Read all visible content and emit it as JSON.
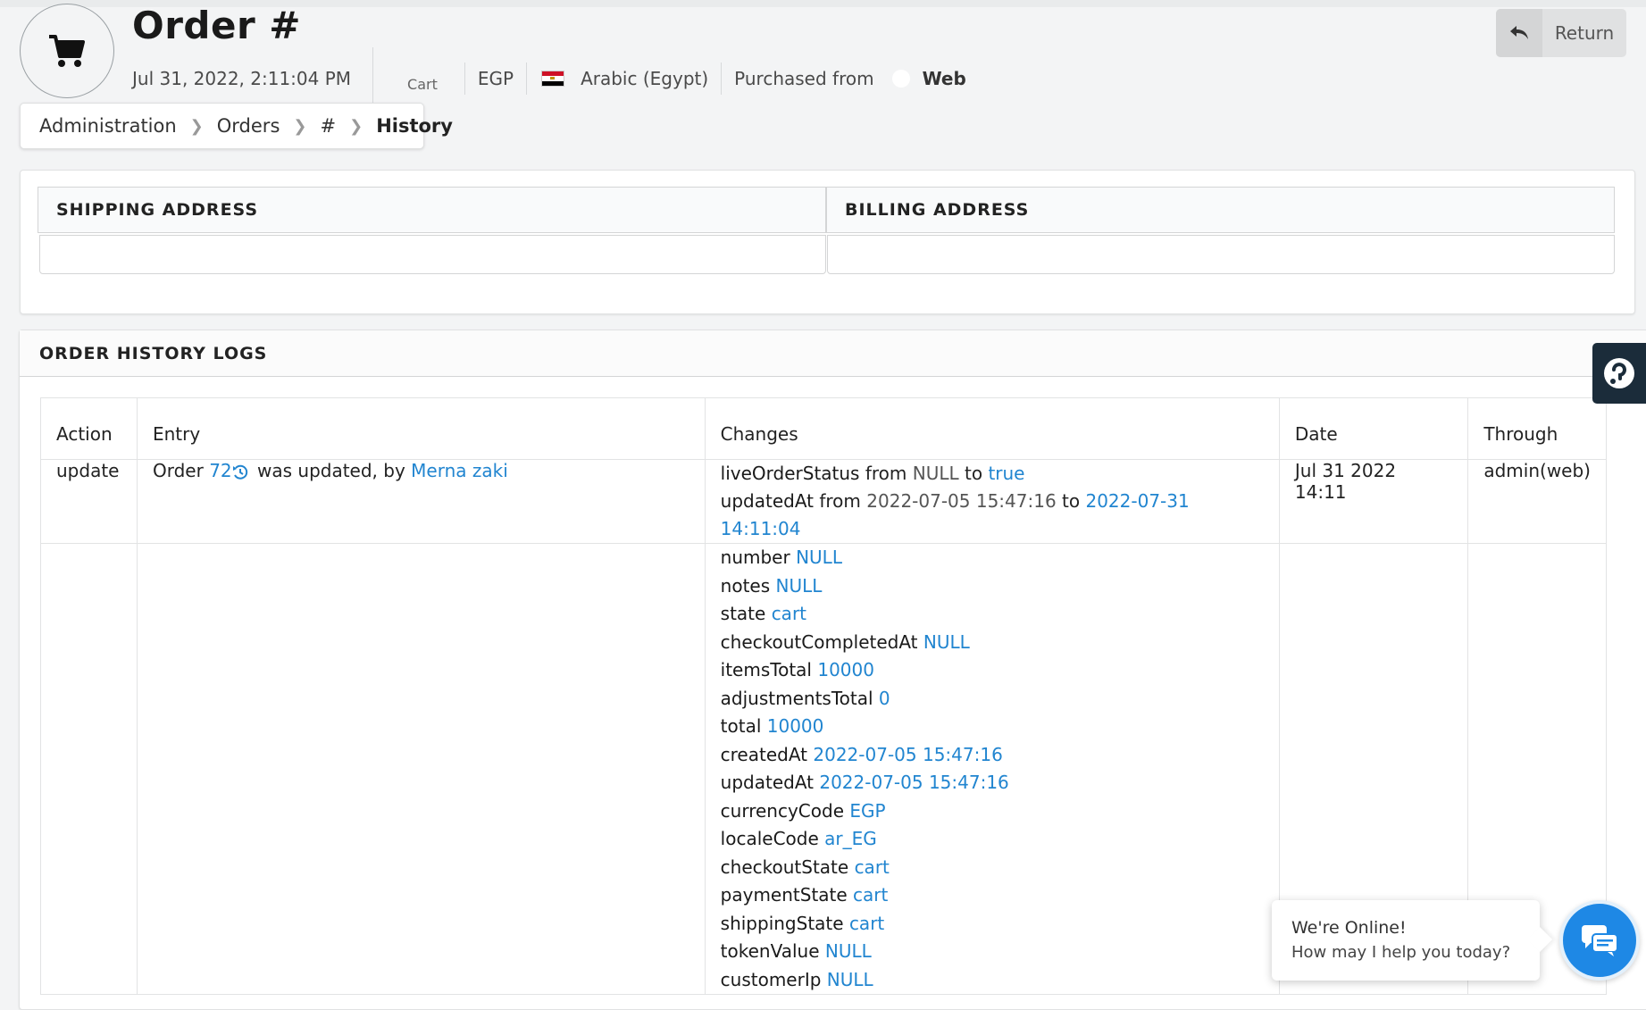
{
  "header": {
    "title": "Order #",
    "date": "Jul 31, 2022, 2:11:04 PM",
    "cart_label": "Cart",
    "currency": "EGP",
    "locale": "Arabic (Egypt)",
    "purchased_from": "Purchased from",
    "channel": "Web"
  },
  "return_button": {
    "label": "Return"
  },
  "breadcrumb": {
    "items": [
      "Administration",
      "Orders",
      "#"
    ],
    "active": "History"
  },
  "addresses": {
    "shipping_title": "SHIPPING ADDRESS",
    "billing_title": "BILLING ADDRESS"
  },
  "history": {
    "title": "ORDER HISTORY LOGS",
    "columns": [
      "Action",
      "Entry",
      "Changes",
      "Date",
      "Through"
    ],
    "row1": {
      "action": "update",
      "entry_prefix": "Order",
      "entry_id": "72",
      "entry_middle": "was updated, by",
      "entry_user": "Merna zaki",
      "changes": [
        {
          "key": "liveOrderStatus",
          "from_label": "from",
          "from": "NULL",
          "to_label": "to",
          "to": "true"
        },
        {
          "key": "updatedAt",
          "from_label": "from",
          "from": "2022-07-05 15:47:16",
          "to_label": "to",
          "to": "2022-07-31 14:11:04"
        }
      ],
      "date": "Jul 31 2022 14:11",
      "through": "admin(web)"
    },
    "row2": {
      "changes": [
        {
          "key": "number",
          "value": "NULL"
        },
        {
          "key": "notes",
          "value": "NULL"
        },
        {
          "key": "state",
          "value": "cart"
        },
        {
          "key": "checkoutCompletedAt",
          "value": "NULL"
        },
        {
          "key": "itemsTotal",
          "value": "10000"
        },
        {
          "key": "adjustmentsTotal",
          "value": "0"
        },
        {
          "key": "total",
          "value": "10000"
        },
        {
          "key": "createdAt",
          "value": "2022-07-05 15:47:16"
        },
        {
          "key": "updatedAt",
          "value": "2022-07-05 15:47:16"
        },
        {
          "key": "currencyCode",
          "value": "EGP"
        },
        {
          "key": "localeCode",
          "value": "ar_EG"
        },
        {
          "key": "checkoutState",
          "value": "cart"
        },
        {
          "key": "paymentState",
          "value": "cart"
        },
        {
          "key": "shippingState",
          "value": "cart"
        },
        {
          "key": "tokenValue",
          "value": "NULL"
        },
        {
          "key": "customerIp",
          "value": "NULL"
        }
      ]
    }
  },
  "chat": {
    "title": "We're Online!",
    "subtitle": "How may I help you today?"
  },
  "colors": {
    "link": "#2185d0",
    "chat_button": "#1e88e5",
    "help_tab": "#1b2c3a"
  },
  "icons": {
    "header": "cart-icon",
    "return": "reply-arrow-icon",
    "help": "help-circle-icon",
    "chat": "chat-bubbles-icon",
    "history": "history-icon",
    "flag": "egypt-flag-icon"
  }
}
